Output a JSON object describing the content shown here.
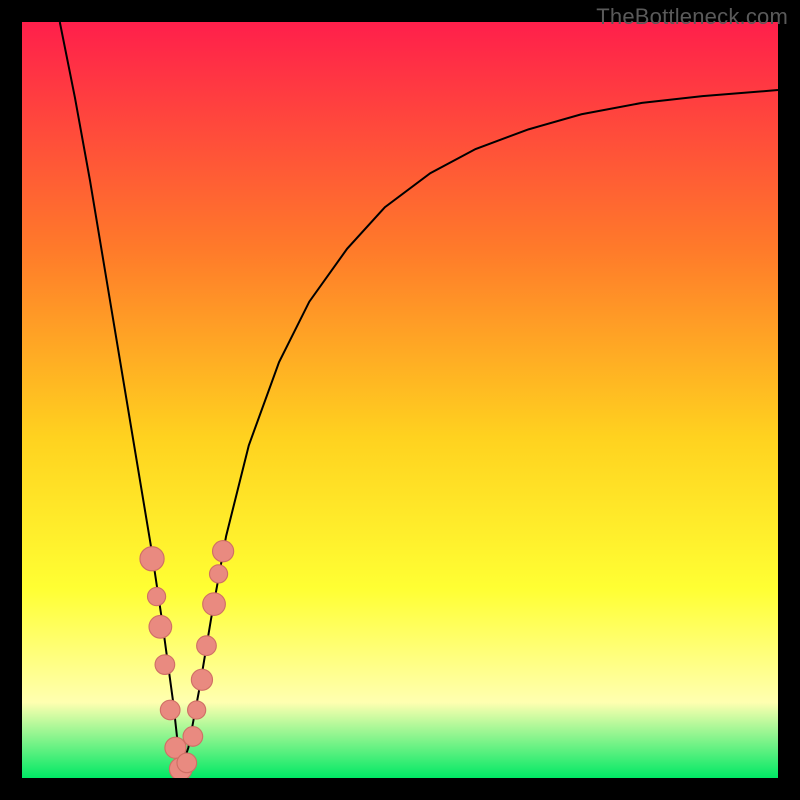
{
  "watermark": "TheBottleneck.com",
  "colors": {
    "frame": "#000000",
    "gradient_top": "#ff1f4b",
    "gradient_mid_upper": "#ff7a2a",
    "gradient_mid": "#ffd21f",
    "gradient_yellow": "#ffff33",
    "gradient_pale": "#ffffb0",
    "gradient_bottom": "#00e865",
    "curve": "#000000",
    "marker_fill": "#e98a80",
    "marker_stroke": "#cf6f65"
  },
  "chart_data": {
    "type": "line",
    "title": "",
    "xlabel": "",
    "ylabel": "",
    "xlim": [
      0,
      100
    ],
    "ylim": [
      0,
      100
    ],
    "notch_x": 21,
    "series": [
      {
        "name": "bottleneck-curve",
        "x": [
          5,
          7,
          9,
          11,
          13,
          15,
          17,
          18.5,
          20,
          21,
          22,
          23.5,
          25,
          27,
          30,
          34,
          38,
          43,
          48,
          54,
          60,
          67,
          74,
          82,
          90,
          100
        ],
        "y": [
          100,
          90,
          79,
          67,
          55,
          43,
          31,
          21,
          10,
          1,
          4,
          12,
          21,
          32,
          44,
          55,
          63,
          70,
          75.5,
          80,
          83.2,
          85.8,
          87.8,
          89.3,
          90.2,
          91
        ]
      }
    ],
    "markers": {
      "name": "highlighted-points",
      "points": [
        {
          "x": 17.2,
          "y": 29,
          "r": 1.6
        },
        {
          "x": 17.8,
          "y": 24,
          "r": 1.2
        },
        {
          "x": 18.3,
          "y": 20,
          "r": 1.5
        },
        {
          "x": 18.9,
          "y": 15,
          "r": 1.3
        },
        {
          "x": 19.6,
          "y": 9,
          "r": 1.3
        },
        {
          "x": 20.3,
          "y": 4,
          "r": 1.4
        },
        {
          "x": 21.0,
          "y": 1.2,
          "r": 1.5
        },
        {
          "x": 21.8,
          "y": 2.0,
          "r": 1.3
        },
        {
          "x": 22.6,
          "y": 5.5,
          "r": 1.3
        },
        {
          "x": 23.1,
          "y": 9,
          "r": 1.2
        },
        {
          "x": 23.8,
          "y": 13,
          "r": 1.4
        },
        {
          "x": 24.4,
          "y": 17.5,
          "r": 1.3
        },
        {
          "x": 25.4,
          "y": 23,
          "r": 1.5
        },
        {
          "x": 26.0,
          "y": 27,
          "r": 1.2
        },
        {
          "x": 26.6,
          "y": 30,
          "r": 1.4
        }
      ]
    }
  }
}
